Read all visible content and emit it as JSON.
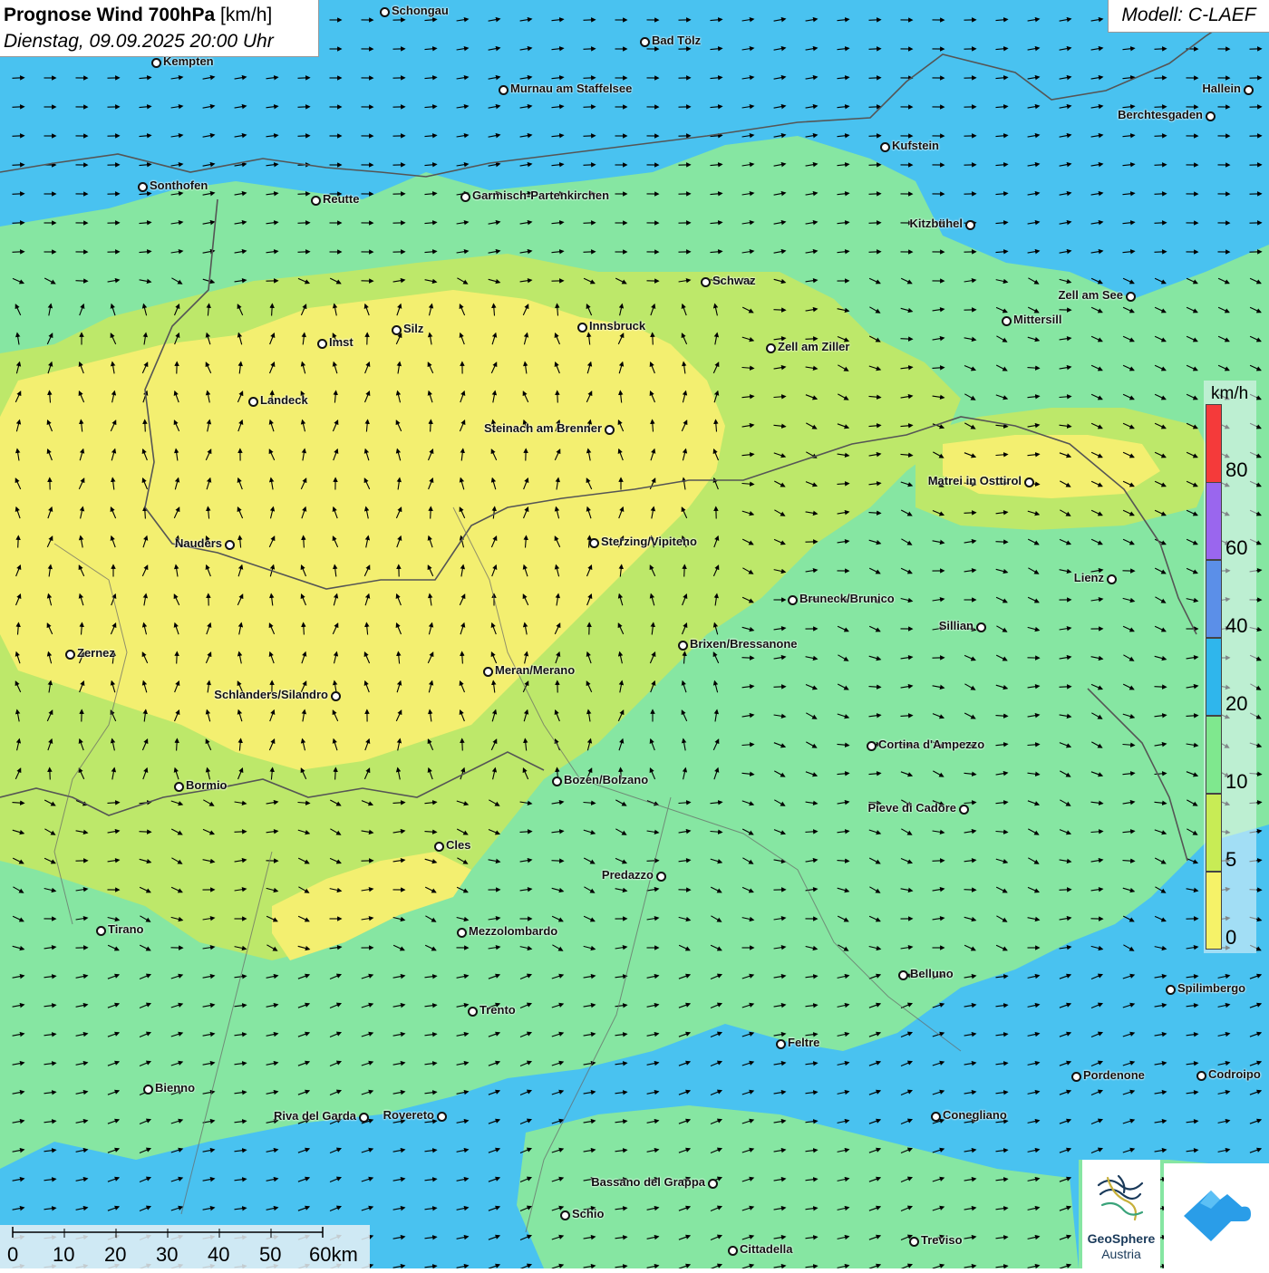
{
  "title": {
    "main_bold": "Prognose Wind 700hPa",
    "main_unit": "[km/h]",
    "subtitle": "Dienstag, 09.09.2025 20:00 Uhr"
  },
  "model": "Modell: C-LAEF",
  "legend": {
    "unit": "km/h",
    "ticks": [
      "80",
      "60",
      "40",
      "20",
      "10",
      "5",
      "0"
    ],
    "colors": [
      "#f53a3a",
      "#9a66ee",
      "#5b8fe8",
      "#2fb6ec",
      "#7fe88e",
      "#c8ec55",
      "#f6f268"
    ]
  },
  "scale_bar": {
    "labels": [
      "0",
      "10",
      "20",
      "30",
      "40",
      "50",
      "60km"
    ]
  },
  "logos": {
    "geosphere_line1": "GeoSphere",
    "geosphere_line2": "Austria"
  },
  "cities": [
    "Schongau",
    "Bad Tölz",
    "Kempten",
    "Murnau am Staffelsee",
    "Hallein",
    "Berchtesgaden",
    "Kufstein",
    "Sonthofen",
    "Reutte",
    "Garmisch-Partenkirchen",
    "Kitzbühel",
    "Schwaz",
    "Zell am See",
    "Mittersill",
    "Innsbruck",
    "Silz",
    "Imst",
    "Zell am Ziller",
    "Landeck",
    "Steinach am Brenner",
    "Matrei in Osttirol",
    "Nauders",
    "Sterzing/Vipiteno",
    "Lienz",
    "Bruneck/Brunico",
    "Sillian",
    "Brixen/Bressanone",
    "Zernez",
    "Meran/Merano",
    "Schlanders/Silandro",
    "Cortina d'Ampezzo",
    "Bozen/Bolzano",
    "Bormio",
    "Pieve di Cadore",
    "Cles",
    "Predazzo",
    "Tirano",
    "Mezzolombardo",
    "Belluno",
    "Spilimbergo",
    "Trento",
    "Feltre",
    "Pordenone",
    "Codroipo",
    "Bienno",
    "Riva del Garda",
    "Rovereto",
    "Conegliano",
    "Bassano del Grappa",
    "Schio",
    "Treviso",
    "Cittadella"
  ]
}
